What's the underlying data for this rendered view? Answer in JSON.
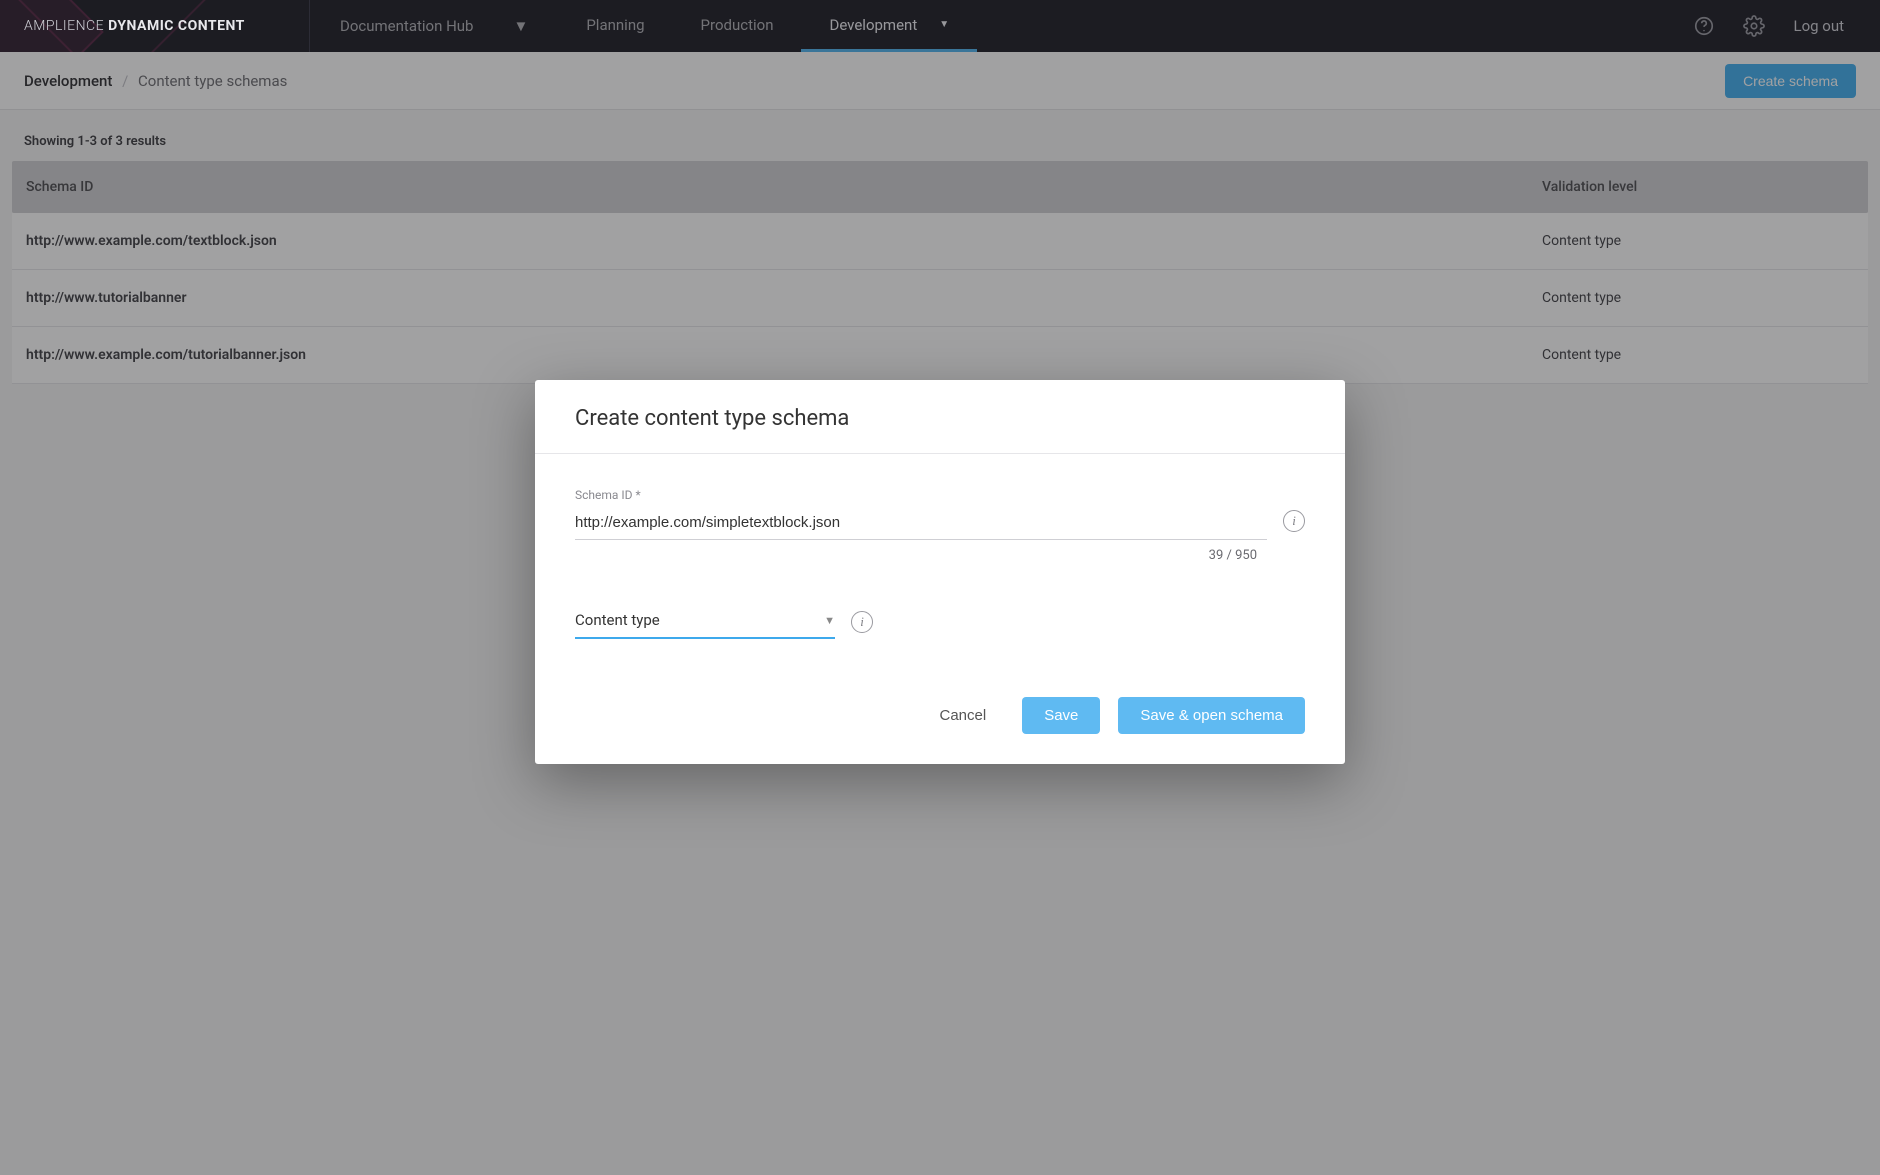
{
  "brand": {
    "light": "AMPLIENCE",
    "bold": "DYNAMIC CONTENT"
  },
  "nav": {
    "hub": "Documentation Hub",
    "tabs": [
      "Planning",
      "Production",
      "Development"
    ],
    "activeTab": "Development",
    "logout": "Log out"
  },
  "breadcrumb": {
    "root": "Development",
    "current": "Content type schemas"
  },
  "actions": {
    "createSchema": "Create schema"
  },
  "results": {
    "summary": "Showing 1-3 of 3 results",
    "columns": {
      "schemaId": "Schema ID",
      "validationLevel": "Validation level"
    },
    "rows": [
      {
        "schemaId": "http://www.example.com/textblock.json",
        "validationLevel": "Content type"
      },
      {
        "schemaId": "http://www.tutorialbanner",
        "validationLevel": "Content type"
      },
      {
        "schemaId": "http://www.example.com/tutorialbanner.json",
        "validationLevel": "Content type"
      }
    ]
  },
  "modal": {
    "title": "Create content type schema",
    "schemaIdLabel": "Schema ID *",
    "schemaIdValue": "http://example.com/simpletextblock.json",
    "charCount": "39 / 950",
    "selectValue": "Content type",
    "buttons": {
      "cancel": "Cancel",
      "save": "Save",
      "saveOpen": "Save & open schema"
    }
  }
}
